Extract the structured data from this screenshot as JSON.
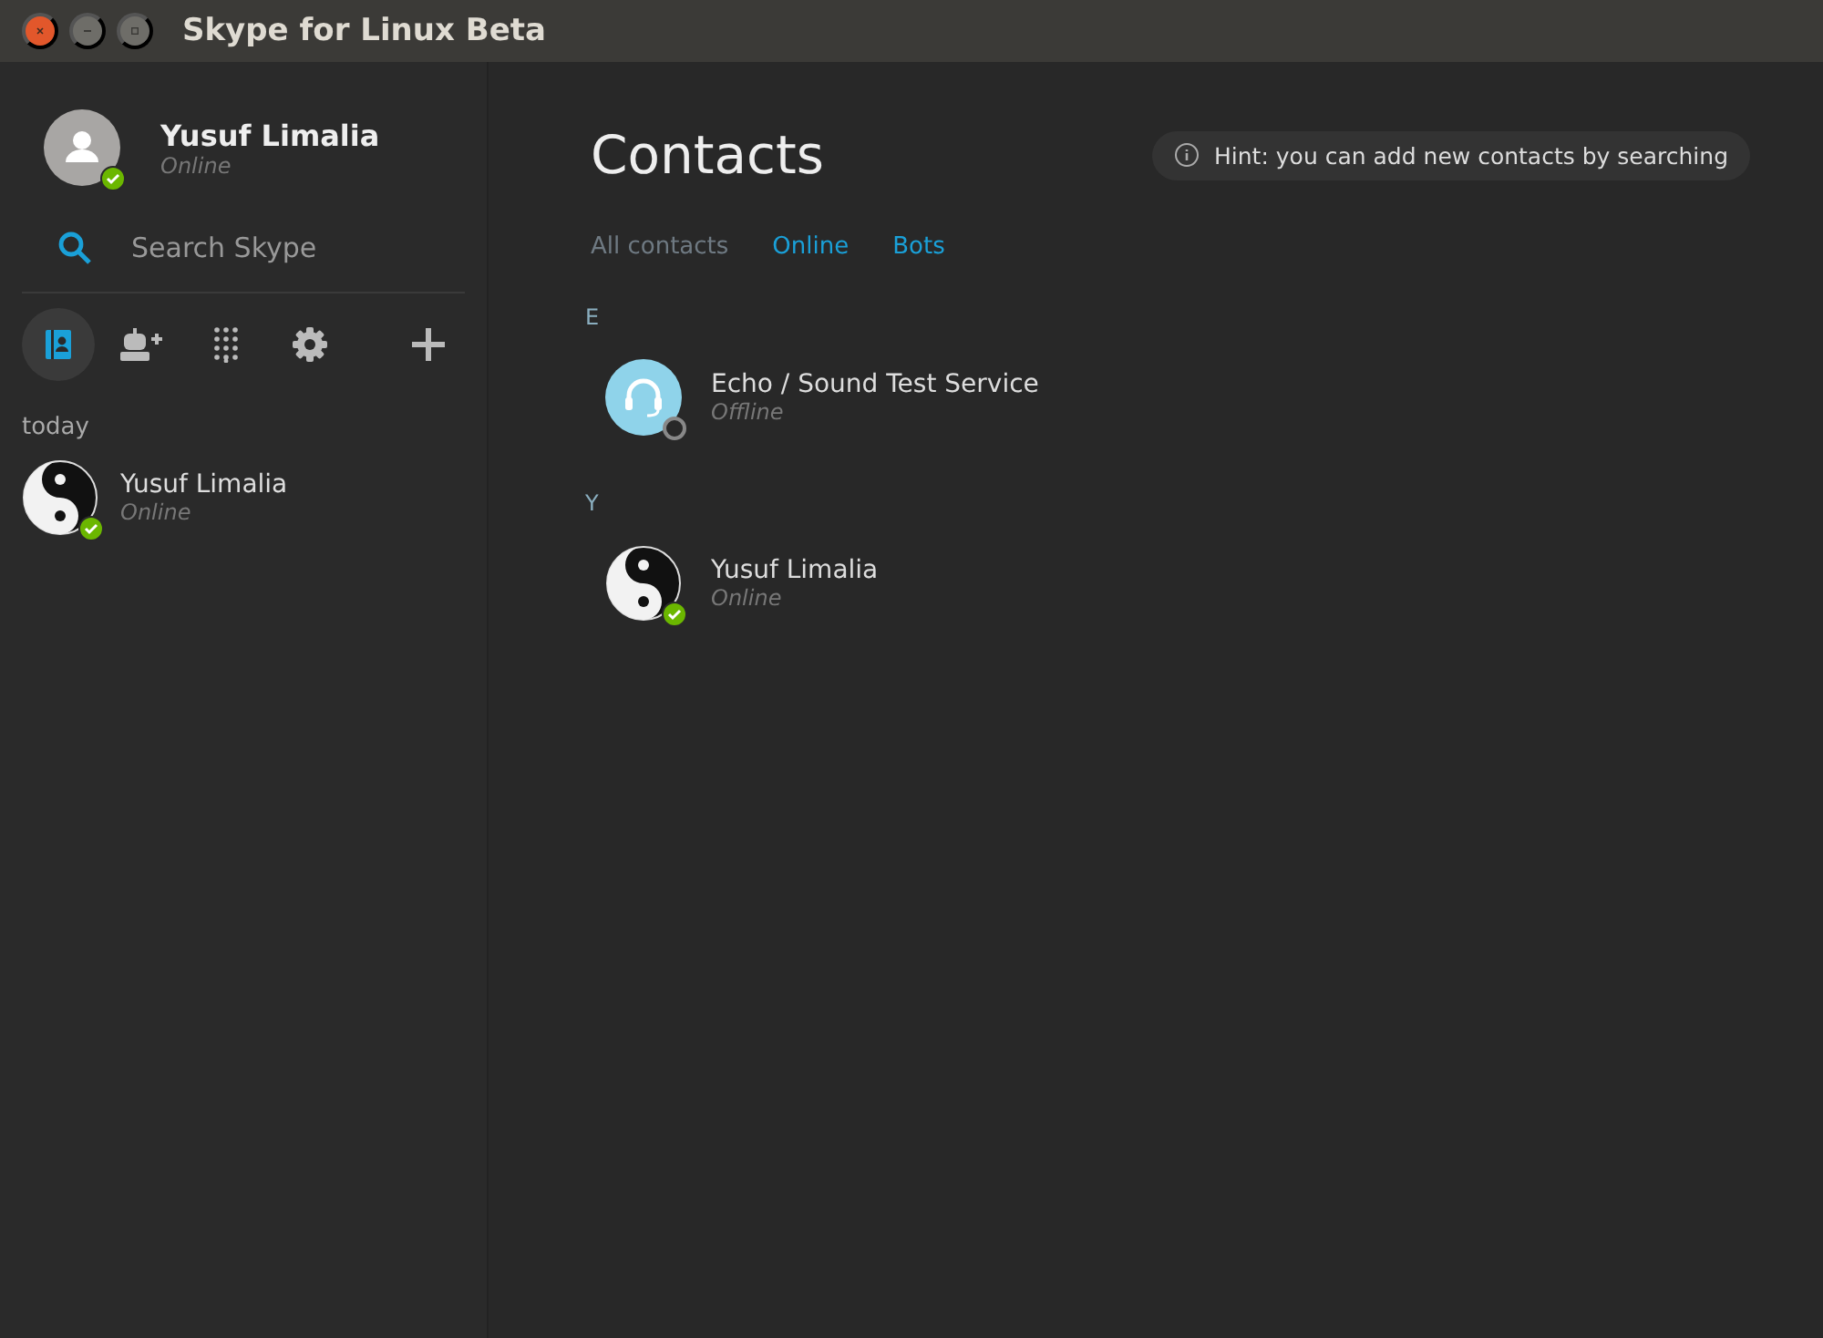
{
  "window": {
    "title": "Skype for Linux Beta"
  },
  "profile": {
    "name": "Yusuf Limalia",
    "status": "Online",
    "online": true,
    "avatar": {
      "kind": "default"
    }
  },
  "search": {
    "placeholder": "Search Skype"
  },
  "nav": [
    {
      "kind": "contacts",
      "selected": true
    },
    {
      "kind": "add-bot",
      "selected": false
    },
    {
      "kind": "dialpad",
      "selected": false
    },
    {
      "kind": "settings",
      "selected": false
    },
    {
      "kind": "add",
      "selected": false
    }
  ],
  "recent": {
    "heading": "today",
    "items": [
      {
        "name": "Yusuf Limalia",
        "status": "Online",
        "online": true,
        "avatar": {
          "kind": "yinyang"
        }
      }
    ]
  },
  "main": {
    "title": "Contacts",
    "hint": "Hint: you can add new contacts by searching",
    "tabs": [
      {
        "label": "All contacts",
        "selected": true
      },
      {
        "label": "Online",
        "selected": false
      },
      {
        "label": "Bots",
        "selected": false
      }
    ],
    "groups": [
      {
        "letter": "E",
        "contacts": [
          {
            "name": "Echo / Sound Test Service",
            "status": "Offline",
            "online": false,
            "avatar": {
              "kind": "headset"
            }
          }
        ]
      },
      {
        "letter": "Y",
        "contacts": [
          {
            "name": "Yusuf Limalia",
            "status": "Online",
            "online": true,
            "avatar": {
              "kind": "yinyang"
            }
          }
        ]
      }
    ]
  }
}
